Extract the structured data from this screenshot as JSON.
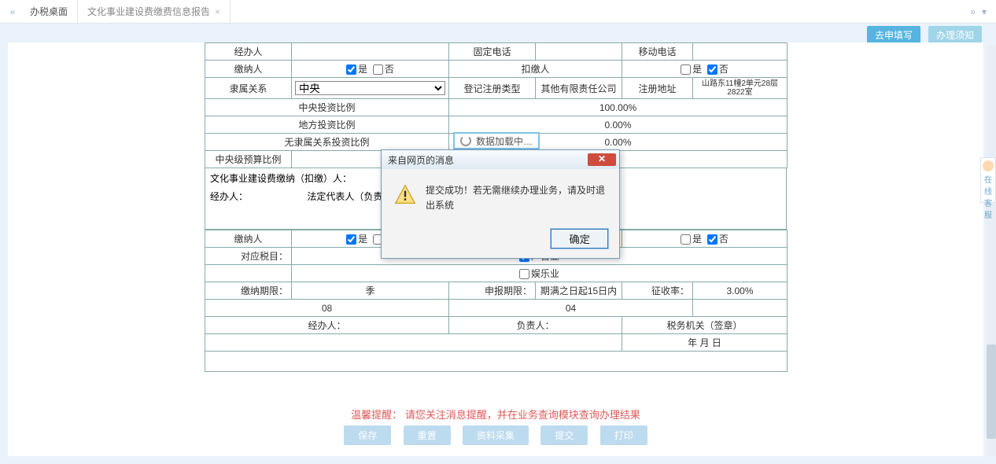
{
  "tabs": {
    "home": "办税桌面",
    "doc": "文化事业建设费缴费信息报告"
  },
  "actions": {
    "fill": "去申填写",
    "handle": "办理须知"
  },
  "row1": {
    "jbr": "经办人",
    "gddh": "固定电话",
    "yddh": "移动电话"
  },
  "row2": {
    "jnr": "缴纳人",
    "yes": "是",
    "no": "否",
    "kjr": "扣缴人"
  },
  "row3": {
    "lsgx": "隶属关系",
    "lsgx_val": "中央",
    "djlx": "登记注册类型",
    "djlx_val": "其他有限责任公司",
    "zcdz": "注册地址",
    "zcdz_val": "山路东11幢2单元28层2822室"
  },
  "ratios": {
    "zy": "中央投资比例",
    "zy_val": "100.00%",
    "df": "地方投资比例",
    "df_val": "0.00%",
    "wls": "无隶属关系投资比例",
    "wls_val": "0.00%",
    "zyj": "中央级预算比例",
    "zyj_val": "0.00"
  },
  "section": {
    "title": "文化事业建设费缴纳（扣缴）人：",
    "jbr": "经办人：",
    "fddb": "法定代表人（负责人）："
  },
  "row_nf": {
    "jnr": "缴纳人",
    "yes": "是",
    "no": "否"
  },
  "row_sm": {
    "dysm": "对应税目：",
    "ggy": "广告业",
    "yly": "娱乐业"
  },
  "row_jn": {
    "jnqx": "缴纳期限：",
    "jnqx_val": "季",
    "sbqx": "申报期限：",
    "sbqx_val": "期满之日起15日内",
    "zsl": "征收率：",
    "zsl_val": "3.00%"
  },
  "row_code": {
    "c1": "08",
    "c2": "04"
  },
  "row_sign": {
    "jbr": "经办人：",
    "fzr": "负责人：",
    "swjg": "税务机关（签章）"
  },
  "row_date": "年    月    日",
  "loading": "数据加载中…",
  "reminder": {
    "pre": "温馨提醒：",
    "msg": "请您关注消息提醒，并在业务查询模块查询办理结果"
  },
  "footerBtns": {
    "b1": "保存",
    "b2": "重置",
    "b3": "资料采集",
    "b4": "提交",
    "b5": "打印"
  },
  "sideHelp": "在线客服",
  "dialog": {
    "title": "来自网页的消息",
    "msg": "提交成功！若无需继续办理业务，请及时退出系统",
    "ok": "确定"
  }
}
